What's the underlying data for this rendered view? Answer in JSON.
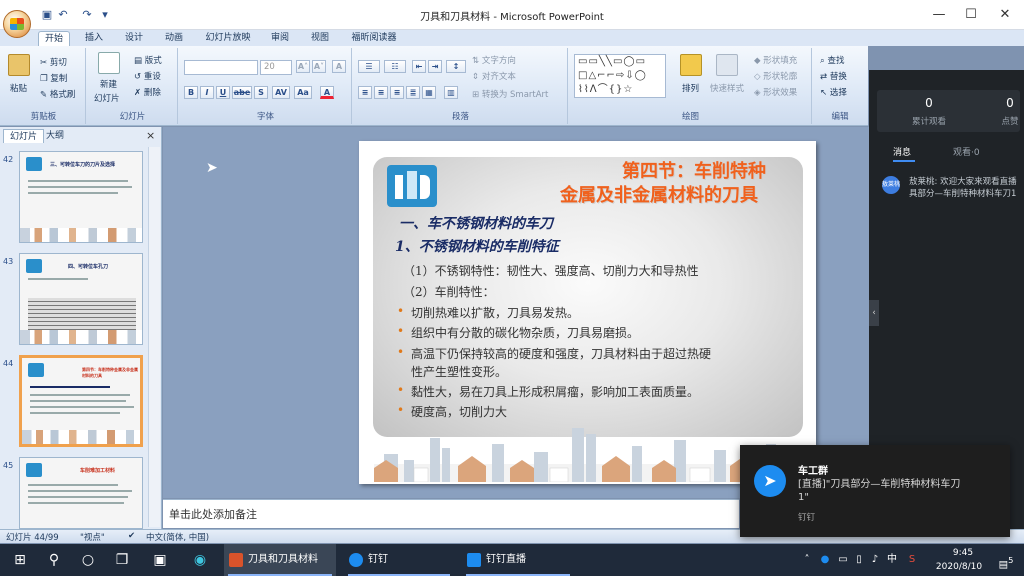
{
  "window": {
    "title": "刀具和刀具材料 - Microsoft PowerPoint",
    "controls": {
      "minimize": "—",
      "maximize": "☐",
      "close": "✕"
    }
  },
  "qat": {
    "undo": "↶",
    "redo": "↷",
    "more": "▾"
  },
  "ribbon": {
    "tabs": [
      "开始",
      "插入",
      "设计",
      "动画",
      "幻灯片放映",
      "审阅",
      "视图",
      "福昕阅读器"
    ],
    "clipboard": {
      "paste": "粘贴",
      "cut": "剪切",
      "copy": "复制",
      "format_painter": "格式刷",
      "label": "剪贴板"
    },
    "slides": {
      "new_slide": "新建",
      "new_slide2": "幻灯片",
      "layout": "版式",
      "reset": "重设",
      "delete": "删除",
      "label": "幻灯片"
    },
    "font": {
      "size_value": "20",
      "label": "字体",
      "bold": "B",
      "italic": "I",
      "underline": "U",
      "strike": "abe",
      "shadow": "S",
      "spacing": "AV",
      "case": "Aa",
      "color": "A",
      "grow": "A˄",
      "shrink": "A˅",
      "clear": "A"
    },
    "paragraph": {
      "text_direction": "文字方向",
      "align_text": "对齐文本",
      "smartart": "转换为 SmartArt",
      "label": "段落"
    },
    "drawing": {
      "arrange": "排列",
      "quick_styles": "快速样式",
      "fill": "形状填充",
      "outline": "形状轮廓",
      "effects": "形状效果",
      "label": "绘图"
    },
    "editing": {
      "find": "查找",
      "replace": "替换",
      "select": "选择",
      "label": "编辑"
    }
  },
  "panel": {
    "tabs": [
      "幻灯片",
      "大纲"
    ],
    "close": "×",
    "thumbs": [
      {
        "num": "42",
        "title": "三、可转位车刀的刀片及选择"
      },
      {
        "num": "43",
        "title": "四、可转位车孔刀"
      },
      {
        "num": "44",
        "title": "第四节：车削特种金属及非金属材料的刀具"
      },
      {
        "num": "45",
        "title": "车削难加工材料"
      }
    ]
  },
  "slide": {
    "title_line1": "第四节：车削特种",
    "title_line2": "金属及非金属材料的刀具",
    "head1": "一、车不锈钢材料的车刀",
    "head2": "1、不锈钢材料的车削特征",
    "body1": "（1）不锈钢特性：韧性大、强度高、切削力大和导热性",
    "body2": "（2）车削特性：",
    "bullet_char": "•",
    "bullets": [
      "切削热难以扩散，刀具易发热。",
      "组织中有分散的碳化物杂质，刀具易磨损。",
      "高温下仍保持较高的硬度和强度，刀具材料由于超过热硬",
      "性产生塑性变形。",
      "黏性大，易在刀具上形成积屑瘤，影响加工表面质量。",
      "硬度高，切削力大"
    ]
  },
  "notes": {
    "placeholder": "单击此处添加备注"
  },
  "status": {
    "slide": "幻灯片 44/99",
    "theme": "\"视点\"",
    "lang": "中文(简体, 中国)"
  },
  "live": {
    "views_value": "0",
    "views_label": "累计观看",
    "likes_value": "0",
    "likes_label": "点赞",
    "tab_messages": "消息",
    "tab_watching": "观看·0",
    "msg_avatar": "敖莱桃",
    "msg_line1": "敖莱桃: 欢迎大家来观看直播",
    "msg_line2": "具部分—车削特种材料车刀1",
    "collapse": "‹"
  },
  "toast": {
    "title": "车工群",
    "body": "[直播]\"刀具部分—车削特种材料车刀\n1\"",
    "app": "钉钉"
  },
  "taskbar": {
    "apps": [
      {
        "label": "刀具和刀具材料",
        "color": "#d9532b"
      },
      {
        "label": "钉钉",
        "color": "#1d8cf0"
      },
      {
        "label": "钉钉直播",
        "color": "#1d8cf0"
      }
    ],
    "ime": "中",
    "time": "9:45",
    "date": "2020/8/10",
    "notif": "5"
  }
}
